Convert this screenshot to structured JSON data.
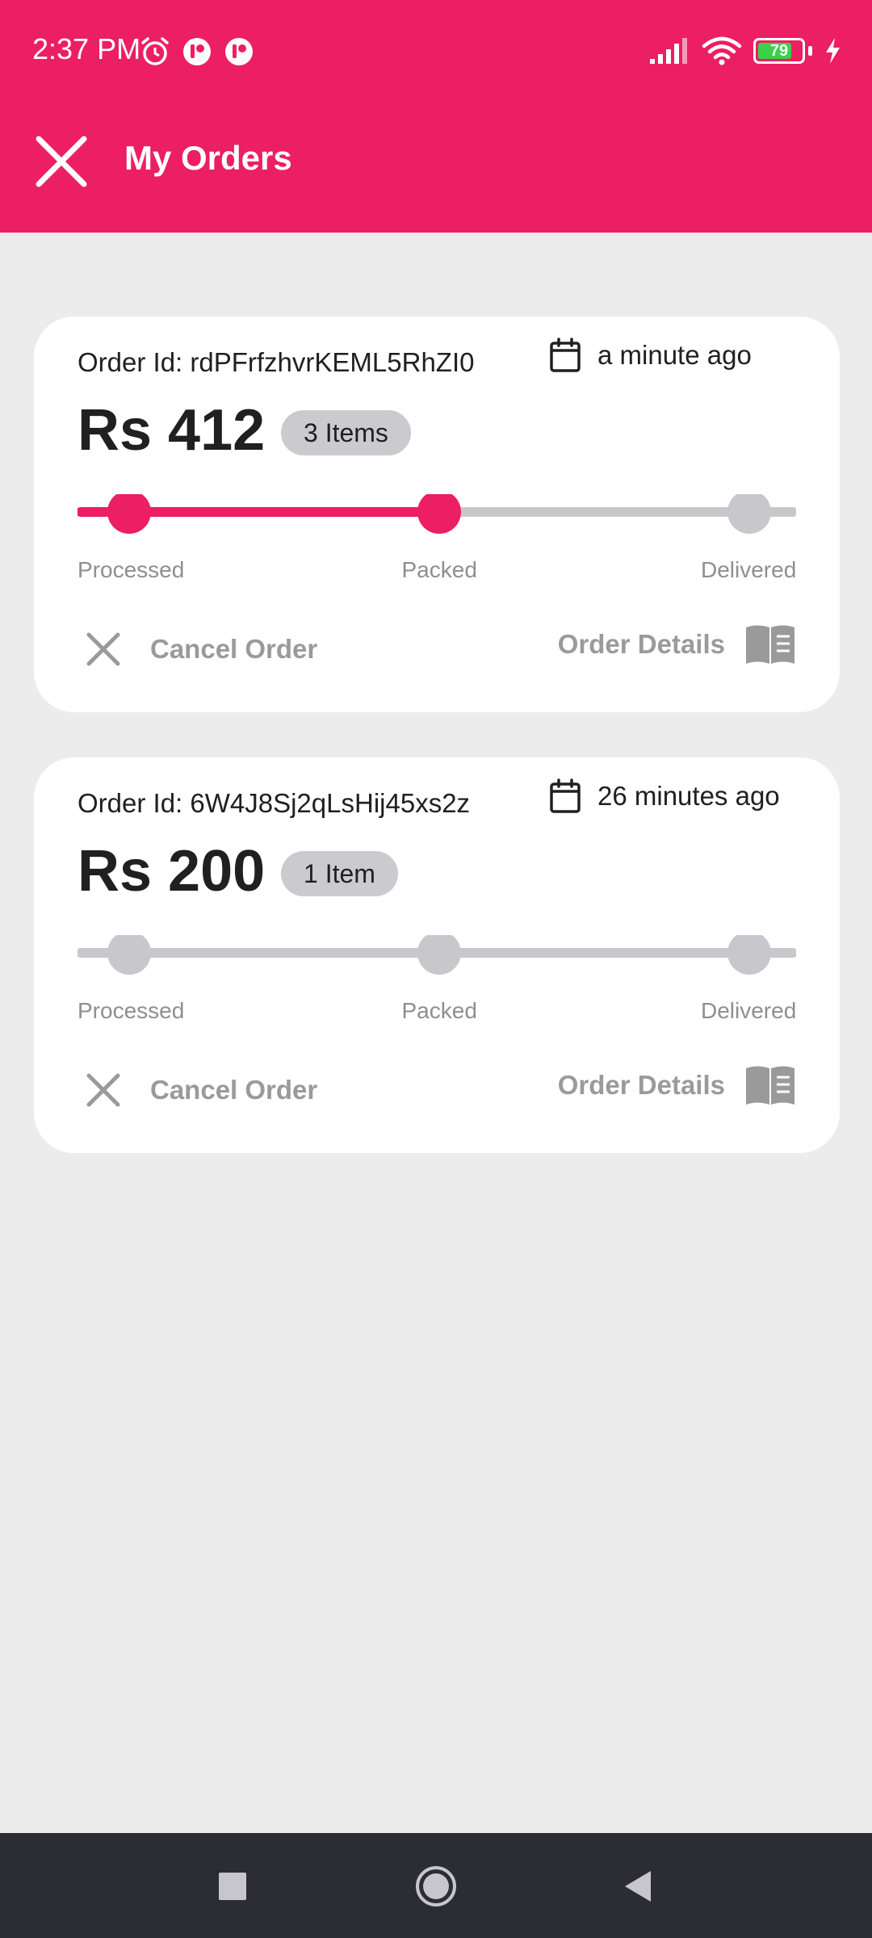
{
  "status_bar": {
    "time": "2:37 PM",
    "battery_level": "79",
    "battery_fraction": 0.79,
    "icons": [
      "alarm-icon",
      "app-notification-icon",
      "app-notification-icon",
      "signal-icon",
      "wifi-icon",
      "battery-icon",
      "charging-icon"
    ]
  },
  "app_bar": {
    "title": "My Orders",
    "close_icon": "close-icon"
  },
  "orders": [
    {
      "order_id": "Order Id: rdPFrfzhvrKEML5RhZI0",
      "time": "a minute ago",
      "amount": "Rs 412",
      "items": "3 Items",
      "steps": [
        "Processed",
        "Packed",
        "Delivered"
      ],
      "completed_steps": 2,
      "cancel_label": "Cancel Order",
      "details_label": "Order Details"
    },
    {
      "order_id": "Order Id: 6W4J8Sj2qLsHij45xs2z",
      "time": "26 minutes ago",
      "amount": "Rs 200",
      "items": "1 Item",
      "steps": [
        "Processed",
        "Packed",
        "Delivered"
      ],
      "completed_steps": 0,
      "cancel_label": "Cancel Order",
      "details_label": "Order Details"
    }
  ],
  "nav_bar": {
    "buttons": [
      "recents-button",
      "home-button",
      "back-button"
    ]
  },
  "colors": {
    "accent": "#ec1e64",
    "inactive": "#c8c8cc",
    "background": "#ececec",
    "nav": "#2c2c33"
  }
}
